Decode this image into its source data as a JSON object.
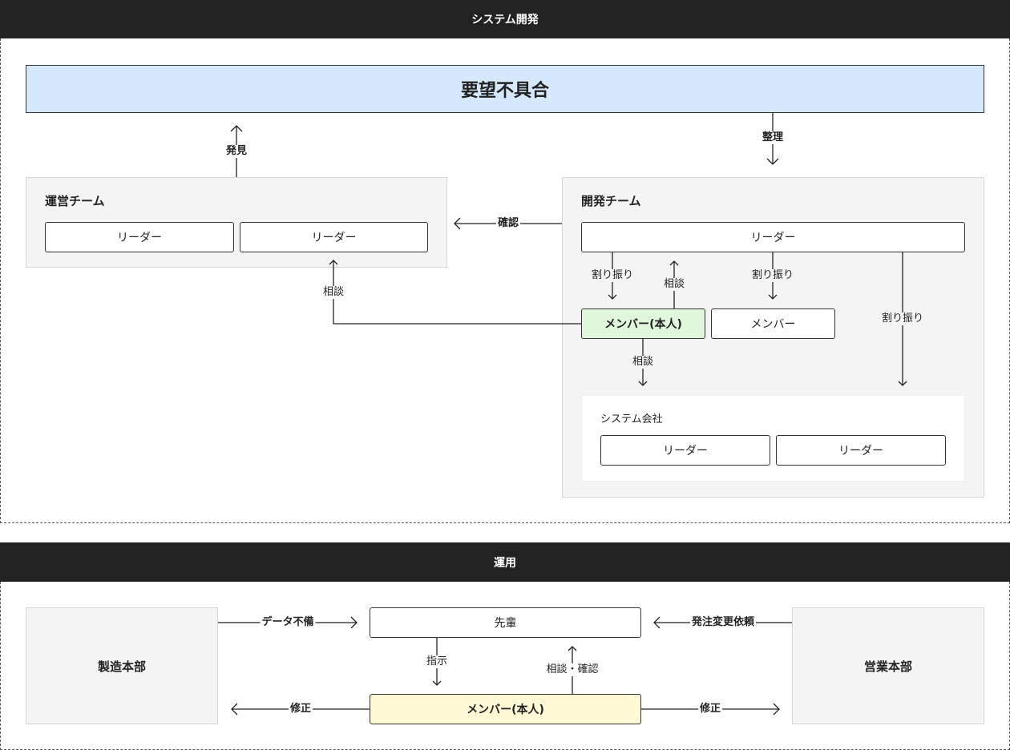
{
  "sections": {
    "system_dev": "システム開発",
    "operation": "運用"
  },
  "system_dev": {
    "banner": "要望不具合",
    "ops_team": {
      "title": "運営チーム",
      "leaders": [
        "リーダー",
        "リーダー"
      ]
    },
    "dev_team": {
      "title": "開発チーム",
      "leader": "リーダー",
      "self_member": "メンバー(本人)",
      "member": "メンバー"
    },
    "system_company": {
      "title": "システム会社",
      "leaders": [
        "リーダー",
        "リーダー"
      ]
    },
    "edges": {
      "discover": "発見",
      "organize": "整理",
      "confirm": "確認",
      "consult_ops": "相談",
      "assign_left": "割り振り",
      "consult_leader": "相談",
      "assign_member": "割り振り",
      "assign_company": "割り振り",
      "consult_company": "相談"
    }
  },
  "operation": {
    "manufacturing": "製造本部",
    "sales": "営業本部",
    "senior": "先輩",
    "self_member": "メンバー(本人)",
    "edges": {
      "data_missing": "データ不備",
      "order_change": "発注変更依頼",
      "instruct": "指示",
      "consult_confirm": "相談・確認",
      "fix_left": "修正",
      "fix_right": "修正"
    }
  }
}
